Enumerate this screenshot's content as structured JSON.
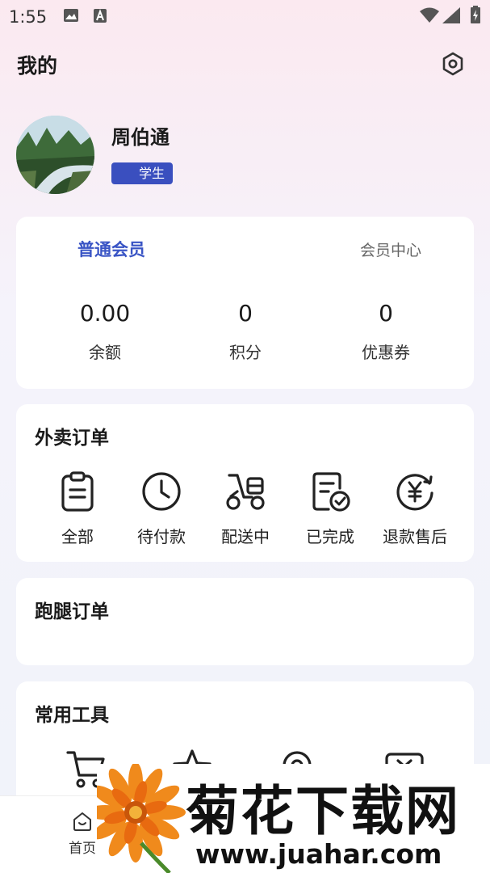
{
  "status_bar": {
    "time": "1:55"
  },
  "header": {
    "title": "我的"
  },
  "profile": {
    "name": "周伯通",
    "role": "学生"
  },
  "member": {
    "level": "普通会员",
    "center_link": "会员中心",
    "stats": [
      {
        "value": "0.00",
        "label": "余额"
      },
      {
        "value": "0",
        "label": "积分"
      },
      {
        "value": "0",
        "label": "优惠券"
      }
    ]
  },
  "takeout_orders": {
    "title": "外卖订单",
    "items": [
      {
        "label": "全部",
        "icon": "clipboard-icon"
      },
      {
        "label": "待付款",
        "icon": "clock-icon"
      },
      {
        "label": "配送中",
        "icon": "scooter-icon"
      },
      {
        "label": "已完成",
        "icon": "completed-doc-icon"
      },
      {
        "label": "退款售后",
        "icon": "refund-yen-icon"
      }
    ]
  },
  "errand_orders": {
    "title": "跑腿订单"
  },
  "tools": {
    "title": "常用工具",
    "icons": [
      "cart-icon",
      "star-icon",
      "location-icon",
      "mail-icon"
    ]
  },
  "bottom_nav": {
    "home_label": "首页"
  },
  "watermark": {
    "title": "菊花下载网",
    "url": "www.juahar.com"
  },
  "colors": {
    "accent": "#3a55c5",
    "badge": "#3a4fbf"
  }
}
